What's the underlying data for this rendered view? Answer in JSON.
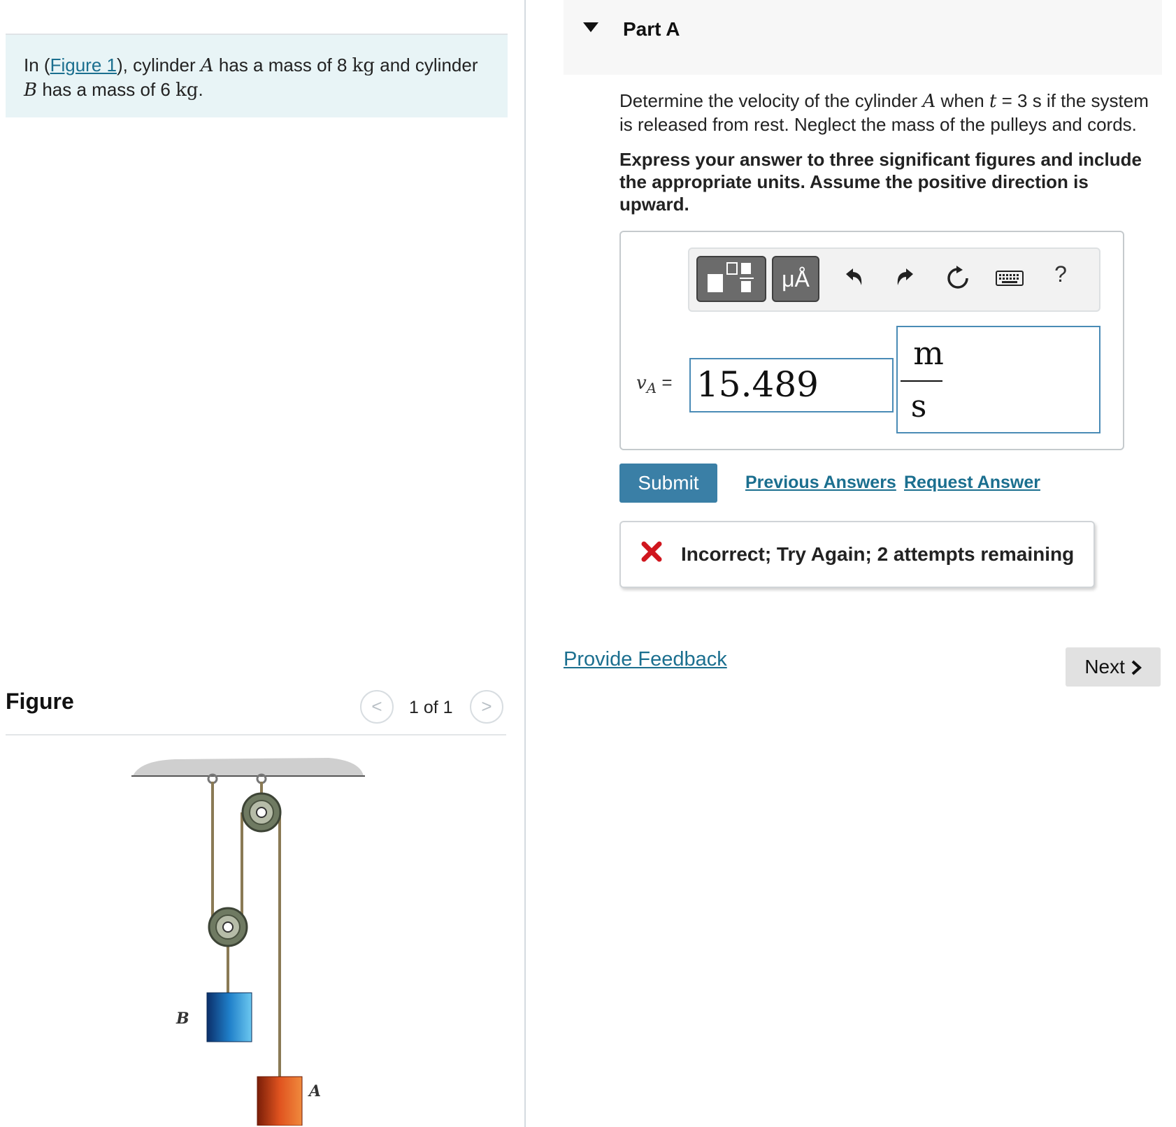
{
  "intro": {
    "prefix": "In (",
    "figure_link": "Figure 1",
    "t1": "), cylinder ",
    "var_a": "A",
    "t2": " has a mass of 8 ",
    "unit1": "kg",
    "t3": " and cylinder ",
    "var_b": "B",
    "t4": " has a mass of 6 ",
    "unit2": "kg",
    "t5": "."
  },
  "figure": {
    "title": "Figure",
    "counter": "1 of 1",
    "prev_icon": "<",
    "next_icon": ">",
    "label_a": "A",
    "label_b": "B",
    "colors": {
      "cylinder_a": "#e0531f",
      "cylinder_b": "#1f7fc9"
    }
  },
  "part": {
    "title": "Part A",
    "question": {
      "t1": "Determine the velocity of the cylinder ",
      "var": "A",
      "t2": " when ",
      "tvar": "t",
      "t3": " = 3 s if the system is released from rest. Neglect the mass of the pulleys and cords."
    },
    "instructions": "Express your answer to three significant figures and include the appropriate units. Assume the positive direction is upward."
  },
  "toolbar": {
    "template_icon": "templates-icon",
    "units_label": "μÅ",
    "undo_icon": "undo-icon",
    "redo_icon": "redo-icon",
    "reset_icon": "reset-icon",
    "keyboard_icon": "keyboard-icon",
    "help_label": "?"
  },
  "answer": {
    "var_main": "v",
    "var_sub": "A",
    "equals": "=",
    "value": "15.489",
    "unit_numerator": "m",
    "unit_denominator": "s"
  },
  "actions": {
    "submit": "Submit",
    "previous_answers": "Previous Answers",
    "request_answer": "Request Answer"
  },
  "feedback": {
    "icon": "x-icon",
    "text": "Incorrect; Try Again; 2 attempts remaining"
  },
  "footer": {
    "provide_feedback": "Provide Feedback",
    "next": "Next"
  },
  "colors": {
    "link": "#1b6f8f",
    "submit_bg": "#3a7fa6",
    "error_red": "#d0161e",
    "intro_bg": "#e8f4f6"
  }
}
